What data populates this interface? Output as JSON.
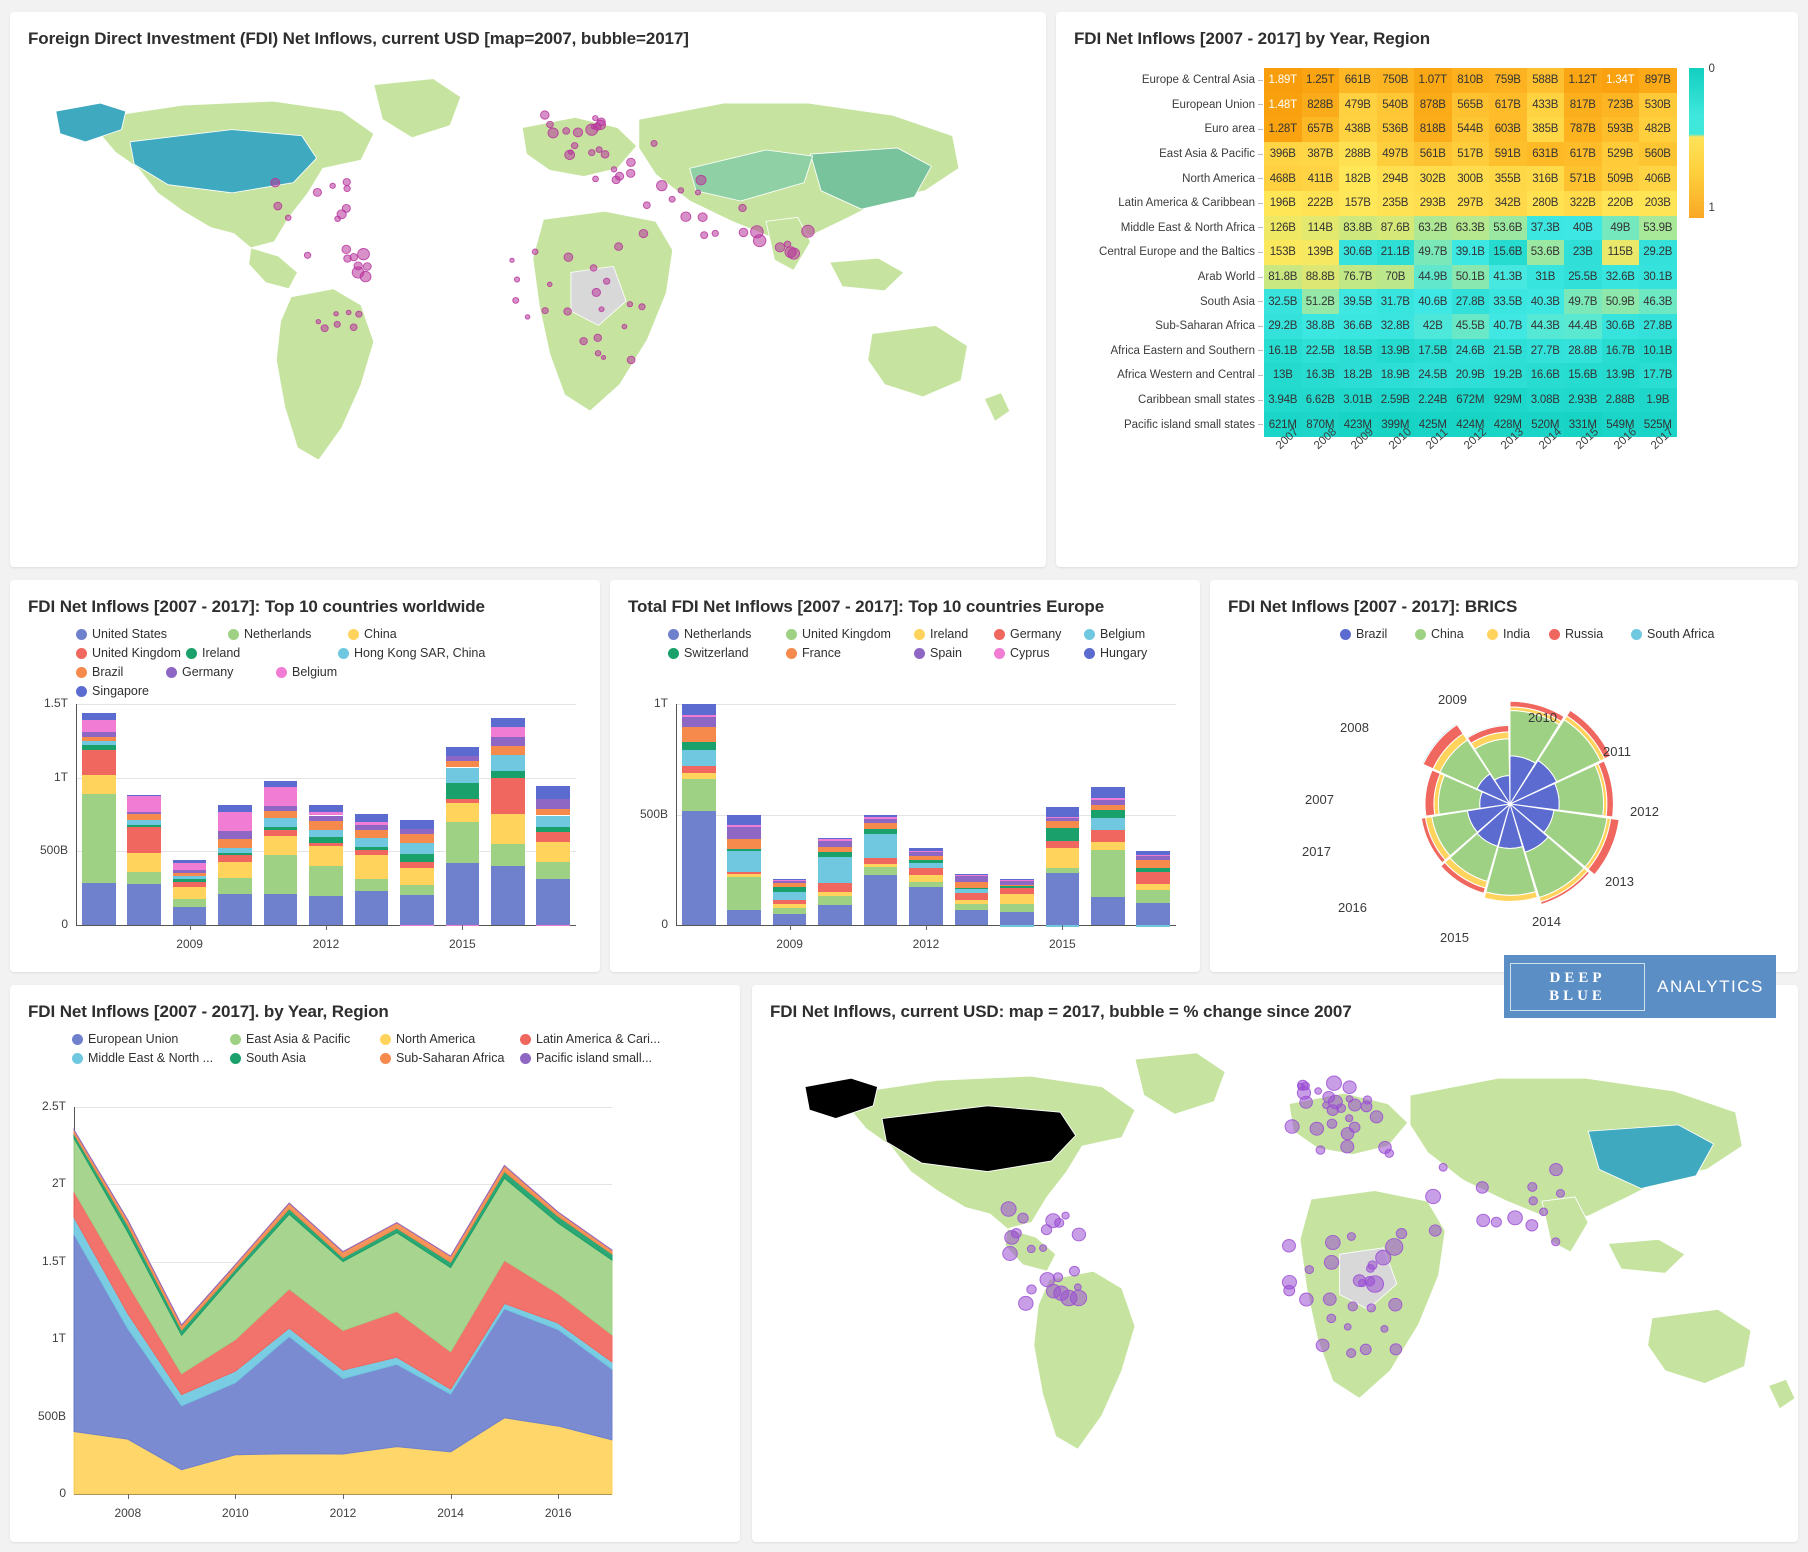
{
  "panels": {
    "map_top_title": "Foreign Direct Investment (FDI) Net Inflows, current USD [map=2007, bubble=2017]",
    "heatmap_title": "FDI Net Inflows [2007 - 2017] by Year, Region",
    "bars_world_title": "FDI Net Inflows [2007 - 2017]: Top 10 countries worldwide",
    "bars_europe_title": "Total FDI Net Inflows [2007 - 2017]: Top 10 countries Europe",
    "brics_title": "FDI Net Inflows [2007 - 2017]: BRICS",
    "area_title": "FDI Net Inflows [2007 - 2017]. by Year, Region",
    "map_bottom_title": "FDI Net Inflows, current USD: map = 2017, bubble = % change since 2007"
  },
  "logo": {
    "line1": "DEEP",
    "line2": "BLUE",
    "word": "ANALYTICS"
  },
  "chart_data": [
    {
      "id": "heatmap",
      "type": "heatmap",
      "title": "FDI Net Inflows [2007 - 2017] by Year, Region",
      "xlabel": "",
      "ylabel": "",
      "categories": [
        "2007",
        "2008",
        "2009",
        "2010",
        "2011",
        "2012",
        "2013",
        "2014",
        "2015",
        "2016",
        "2017"
      ],
      "rows": [
        {
          "label": "Europe & Central Asia",
          "values": [
            "1.89T",
            "1.25T",
            "661B",
            "750B",
            "1.07T",
            "810B",
            "759B",
            "588B",
            "1.12T",
            "1.34T",
            "897B"
          ]
        },
        {
          "label": "European Union",
          "values": [
            "1.48T",
            "828B",
            "479B",
            "540B",
            "878B",
            "565B",
            "617B",
            "433B",
            "817B",
            "723B",
            "530B"
          ]
        },
        {
          "label": "Euro area",
          "values": [
            "1.28T",
            "657B",
            "438B",
            "536B",
            "818B",
            "544B",
            "603B",
            "385B",
            "787B",
            "593B",
            "482B"
          ]
        },
        {
          "label": "East Asia & Pacific",
          "values": [
            "396B",
            "387B",
            "288B",
            "497B",
            "561B",
            "517B",
            "591B",
            "631B",
            "617B",
            "529B",
            "560B"
          ]
        },
        {
          "label": "North America",
          "values": [
            "468B",
            "411B",
            "182B",
            "294B",
            "302B",
            "300B",
            "355B",
            "316B",
            "571B",
            "509B",
            "406B"
          ]
        },
        {
          "label": "Latin America & Caribbean",
          "values": [
            "196B",
            "222B",
            "157B",
            "235B",
            "293B",
            "297B",
            "342B",
            "280B",
            "322B",
            "220B",
            "203B"
          ]
        },
        {
          "label": "Middle East & North Africa",
          "values": [
            "126B",
            "114B",
            "83.8B",
            "87.6B",
            "63.2B",
            "63.3B",
            "53.6B",
            "37.3B",
            "40B",
            "49B",
            "53.9B"
          ]
        },
        {
          "label": "Central Europe and the Baltics",
          "values": [
            "153B",
            "139B",
            "30.6B",
            "21.1B",
            "49.7B",
            "39.1B",
            "15.6B",
            "53.6B",
            "23B",
            "115B",
            "29.2B"
          ]
        },
        {
          "label": "Arab World",
          "values": [
            "81.8B",
            "88.8B",
            "76.7B",
            "70B",
            "44.9B",
            "50.1B",
            "41.3B",
            "31B",
            "25.5B",
            "32.6B",
            "30.1B"
          ]
        },
        {
          "label": "South Asia",
          "values": [
            "32.5B",
            "51.2B",
            "39.5B",
            "31.7B",
            "40.6B",
            "27.8B",
            "33.5B",
            "40.3B",
            "49.7B",
            "50.9B",
            "46.3B"
          ]
        },
        {
          "label": "Sub-Saharan Africa",
          "values": [
            "29.2B",
            "38.8B",
            "36.6B",
            "32.8B",
            "42B",
            "45.5B",
            "40.7B",
            "44.3B",
            "44.4B",
            "30.6B",
            "27.8B"
          ]
        },
        {
          "label": "Africa Eastern and Southern",
          "values": [
            "16.1B",
            "22.5B",
            "18.5B",
            "13.9B",
            "17.5B",
            "24.6B",
            "21.5B",
            "27.7B",
            "28.8B",
            "16.7B",
            "10.1B"
          ]
        },
        {
          "label": "Africa Western and Central",
          "values": [
            "13B",
            "16.3B",
            "18.2B",
            "18.9B",
            "24.5B",
            "20.9B",
            "19.2B",
            "16.6B",
            "15.6B",
            "13.9B",
            "17.7B"
          ]
        },
        {
          "label": "Caribbean small states",
          "values": [
            "3.94B",
            "6.62B",
            "3.01B",
            "2.59B",
            "2.24B",
            "672M",
            "929M",
            "3.08B",
            "2.93B",
            "2.88B",
            "1.9B"
          ]
        },
        {
          "label": "Pacific island small states",
          "values": [
            "621M",
            "870M",
            "423M",
            "399M",
            "425M",
            "424M",
            "428M",
            "520M",
            "331M",
            "549M",
            "525M"
          ]
        }
      ],
      "color_scale": {
        "min_label": "0",
        "max_label": "1",
        "low": "#0fd9c8",
        "mid": "#40e8dc",
        "high": "#ffc107",
        "top": "#f9a825"
      }
    },
    {
      "id": "bars_world",
      "type": "bar",
      "stacked": true,
      "title": "FDI Net Inflows [2007 - 2017]: Top 10 countries worldwide",
      "xlabel": "",
      "ylabel": "",
      "ylim": [
        0,
        1800
      ],
      "yticks": [
        "0",
        "500B",
        "1T",
        "1.5T"
      ],
      "xticks": [
        "2009",
        "2012",
        "2015"
      ],
      "categories": [
        "2007",
        "2008",
        "2009",
        "2010",
        "2011",
        "2012",
        "2013",
        "2014",
        "2015",
        "2016",
        "2017"
      ],
      "series": [
        {
          "name": "United States",
          "color": "#6f81cd",
          "values": [
            340,
            335,
            146,
            252,
            254,
            240,
            279,
            243,
            508,
            483,
            372
          ]
        },
        {
          "name": "Netherlands",
          "color": "#9fd185",
          "values": [
            725,
            95,
            68,
            129,
            317,
            240,
            96,
            85,
            330,
            178,
            139
          ]
        },
        {
          "name": "China",
          "color": "#ffd35c",
          "values": [
            160,
            160,
            95,
            131,
            155,
            160,
            199,
            140,
            159,
            245,
            168
          ]
        },
        {
          "name": "United Kingdom",
          "color": "#f0675f",
          "values": [
            200,
            207,
            40,
            57,
            48,
            31,
            36,
            46,
            33,
            295,
            80
          ]
        },
        {
          "name": "Ireland",
          "color": "#1aa06a",
          "values": [
            40,
            20,
            24,
            20,
            23,
            46,
            28,
            66,
            124,
            54,
            38
          ]
        },
        {
          "name": "Hong Kong SAR, China",
          "color": "#6fc8e0",
          "values": [
            30,
            37,
            26,
            41,
            72,
            59,
            68,
            91,
            129,
            129,
            95
          ]
        },
        {
          "name": "Brazil",
          "color": "#f58a4c",
          "values": [
            34,
            49,
            24,
            71,
            62,
            70,
            64,
            74,
            52,
            75,
            50
          ]
        },
        {
          "name": "Germany",
          "color": "#8e67c4",
          "values": [
            44,
            16,
            26,
            62,
            39,
            46,
            42,
            39,
            45,
            74,
            81
          ]
        },
        {
          "name": "Belgium",
          "color": "#f07cd4",
          "values": [
            100,
            130,
            53,
            161,
            152,
            27,
            28,
            -10,
            -12,
            78,
            -12
          ]
        },
        {
          "name": "Singapore",
          "color": "#5b6bd0",
          "values": [
            51,
            13,
            25,
            55,
            50,
            56,
            65,
            68,
            70,
            77,
            110
          ]
        }
      ]
    },
    {
      "id": "bars_europe",
      "type": "bar",
      "stacked": true,
      "title": "Total FDI Net Inflows [2007 - 2017]: Top 10 countries Europe",
      "xlabel": "",
      "ylabel": "",
      "ylim": [
        0,
        1400
      ],
      "yticks": [
        "0",
        "500B",
        "1T"
      ],
      "xticks": [
        "2009",
        "2012",
        "2015"
      ],
      "categories": [
        "2007",
        "2008",
        "2009",
        "2010",
        "2011",
        "2012",
        "2013",
        "2014",
        "2015",
        "2016",
        "2017"
      ],
      "series": [
        {
          "name": "Netherlands",
          "color": "#6f81cd",
          "values": [
            725,
            95,
            68,
            129,
            317,
            240,
            96,
            85,
            330,
            178,
            139
          ]
        },
        {
          "name": "United Kingdom",
          "color": "#9fd185",
          "values": [
            200,
            207,
            40,
            57,
            48,
            31,
            36,
            46,
            33,
            295,
            80
          ]
        },
        {
          "name": "Ireland",
          "color": "#ffd35c",
          "values": [
            40,
            20,
            24,
            20,
            23,
            46,
            28,
            66,
            124,
            54,
            38
          ]
        },
        {
          "name": "Germany",
          "color": "#f0675f",
          "values": [
            44,
            16,
            26,
            62,
            39,
            46,
            42,
            39,
            45,
            74,
            81
          ]
        },
        {
          "name": "Belgium",
          "color": "#6fc8e0",
          "values": [
            100,
            130,
            53,
            161,
            152,
            27,
            28,
            -10,
            -12,
            78,
            -12
          ]
        },
        {
          "name": "Switzerland",
          "color": "#1aa06a",
          "values": [
            48,
            16,
            32,
            32,
            28,
            22,
            6,
            10,
            82,
            48,
            22
          ]
        },
        {
          "name": "France",
          "color": "#f58a4c",
          "values": [
            96,
            64,
            24,
            34,
            38,
            25,
            34,
            5,
            44,
            35,
            50
          ]
        },
        {
          "name": "Spain",
          "color": "#8e67c4",
          "values": [
            64,
            76,
            10,
            40,
            28,
            26,
            40,
            28,
            21,
            29,
            25
          ]
        },
        {
          "name": "Cyprus",
          "color": "#f07cd4",
          "values": [
            12,
            10,
            8,
            10,
            14,
            9,
            8,
            8,
            7,
            14,
            10
          ]
        },
        {
          "name": "Hungary",
          "color": "#5b6bd0",
          "values": [
            71,
            66,
            5,
            6,
            7,
            14,
            5,
            6,
            62,
            70,
            25
          ]
        }
      ]
    },
    {
      "id": "brics",
      "type": "pie",
      "variant": "radial-stacked",
      "title": "FDI Net Inflows [2007 - 2017]: BRICS",
      "categories": [
        "2007",
        "2008",
        "2009",
        "2010",
        "2011",
        "2012",
        "2013",
        "2014",
        "2015",
        "2016",
        "2017"
      ],
      "series": [
        {
          "name": "Brazil",
          "color": "#5b6bd0",
          "values": [
            35,
            50,
            31,
            88,
            102,
            92,
            75,
            97,
            75,
            74,
            71
          ]
        },
        {
          "name": "China",
          "color": "#9fd185",
          "values": [
            160,
            175,
            131,
            244,
            280,
            241,
            291,
            268,
            242,
            174,
            168
          ]
        },
        {
          "name": "India",
          "color": "#ffd35c",
          "values": [
            25,
            47,
            36,
            27,
            36,
            24,
            28,
            35,
            44,
            44,
            40
          ]
        },
        {
          "name": "Russia",
          "color": "#f0675f",
          "values": [
            55,
            75,
            37,
            43,
            55,
            50,
            69,
            22,
            7,
            38,
            28
          ]
        },
        {
          "name": "South Africa",
          "color": "#6fc8e0",
          "values": [
            6,
            9,
            7,
            4,
            4,
            5,
            8,
            6,
            2,
            2,
            1
          ]
        }
      ]
    },
    {
      "id": "area_regions",
      "type": "area",
      "stacked": true,
      "title": "FDI Net Inflows [2007 - 2017]. by Year, Region",
      "xlabel": "",
      "ylabel": "",
      "ylim": [
        0,
        2900
      ],
      "yticks": [
        "0",
        "500B",
        "1T",
        "1.5T",
        "2T",
        "2.5T"
      ],
      "xticks": [
        "2008",
        "2010",
        "2012",
        "2014",
        "2016"
      ],
      "categories": [
        "2007",
        "2008",
        "2009",
        "2010",
        "2011",
        "2012",
        "2013",
        "2014",
        "2015",
        "2016",
        "2017"
      ],
      "series": [
        {
          "name": "European Union",
          "color": "#6f81cd",
          "values": [
            1480,
            828,
            479,
            540,
            878,
            565,
            617,
            433,
            817,
            723,
            530
          ]
        },
        {
          "name": "East Asia & Pacific",
          "color": "#9fd185",
          "values": [
            396,
            387,
            288,
            497,
            561,
            517,
            591,
            631,
            617,
            529,
            560
          ]
        },
        {
          "name": "North America",
          "color": "#ffd35c",
          "values": [
            468,
            411,
            182,
            294,
            302,
            300,
            355,
            316,
            571,
            509,
            406
          ]
        },
        {
          "name": "Latin America & Cari...",
          "color": "#f0675f",
          "values": [
            196,
            222,
            157,
            235,
            293,
            297,
            342,
            280,
            322,
            220,
            203
          ]
        },
        {
          "name": "Middle East & North ...",
          "color": "#6fc8e0",
          "values": [
            126,
            114,
            83.8,
            87.6,
            63.2,
            63.3,
            53.6,
            37.3,
            40,
            49,
            53.9
          ]
        },
        {
          "name": "South Asia",
          "color": "#1aa06a",
          "values": [
            32.5,
            51.2,
            39.5,
            31.7,
            40.6,
            27.8,
            33.5,
            40.3,
            49.7,
            50.9,
            46.3
          ]
        },
        {
          "name": "Sub-Saharan Africa",
          "color": "#f58a4c",
          "values": [
            29.2,
            38.8,
            36.6,
            32.8,
            42,
            45.5,
            40.7,
            44.3,
            44.4,
            30.6,
            27.8
          ]
        },
        {
          "name": "Pacific island small...",
          "color": "#8e67c4",
          "values": [
            0.621,
            0.87,
            0.423,
            0.399,
            0.425,
            0.424,
            0.428,
            0.52,
            0.331,
            0.549,
            0.525
          ]
        }
      ]
    },
    {
      "id": "map_top",
      "type": "map",
      "title": "Foreign Direct Investment (FDI) Net Inflows, current USD [map=2007, bubble=2017]",
      "map_year": 2007,
      "bubble_year": 2017,
      "bubble_color": "#b8359c"
    },
    {
      "id": "map_bottom",
      "type": "map",
      "title": "FDI Net Inflows, current USD: map = 2017, bubble = % change since 2007",
      "map_year": 2017,
      "bubble_metric": "% change since 2007",
      "bubble_color": "#9b4fd4"
    }
  ]
}
